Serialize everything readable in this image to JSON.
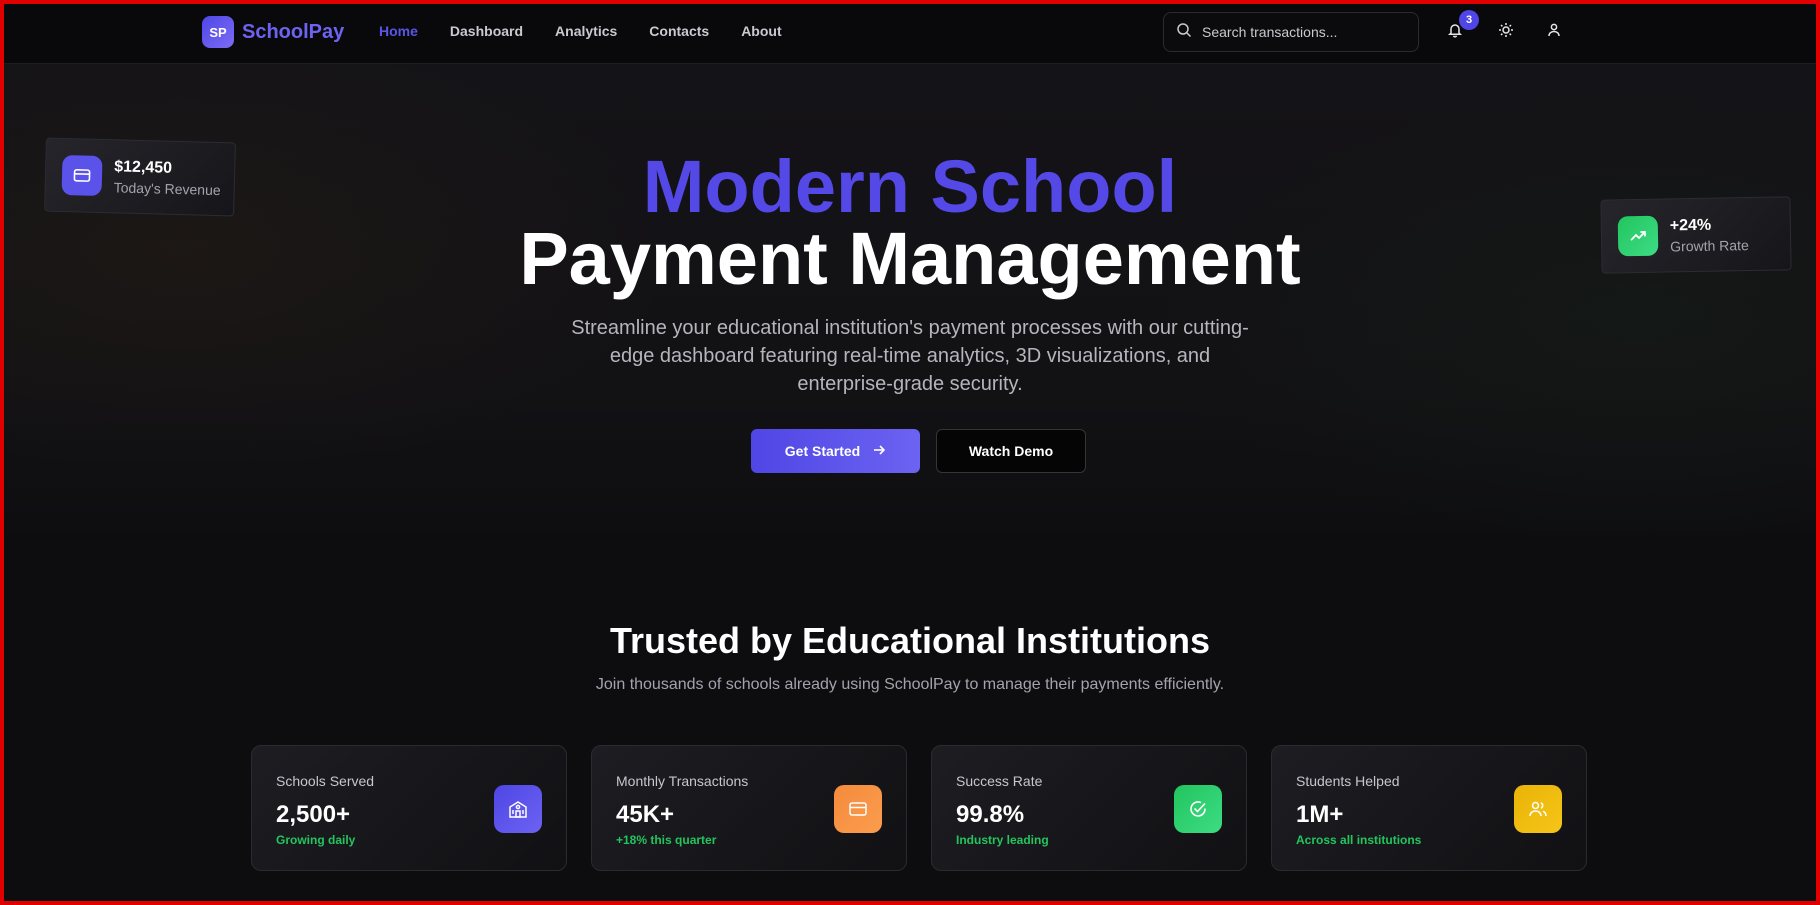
{
  "app": {
    "logo_badge": "SP",
    "name": "SchoolPay"
  },
  "nav": {
    "links": [
      "Home",
      "Dashboard",
      "Analytics",
      "Contacts",
      "About"
    ],
    "active": "Home"
  },
  "search": {
    "placeholder": "Search transactions...",
    "icon": "search-icon"
  },
  "notifications": {
    "count": "3",
    "icon": "bell-icon"
  },
  "theme_toggle": {
    "icon": "sun-icon"
  },
  "user_menu": {
    "icon": "user-icon"
  },
  "floating_cards": {
    "revenue": {
      "value": "$12,450",
      "label": "Today's Revenue",
      "icon": "credit-card-icon",
      "color": "#5b52ea"
    },
    "growth": {
      "value": "+24%",
      "label": "Growth Rate",
      "icon": "trending-up-icon",
      "color": "#22c55e"
    }
  },
  "hero": {
    "title_line1": "Modern School",
    "title_line2": "Payment Management",
    "subtitle": "Streamline your educational institution's payment processes with our cutting-edge dashboard featuring real-time analytics, 3D visualizations, and enterprise-grade security.",
    "primary_button": "Get Started",
    "secondary_button": "Watch Demo",
    "accent_color": "#5448e6"
  },
  "stats_section": {
    "title": "Trusted by Educational Institutions",
    "subtitle": "Join thousands of schools already using SchoolPay to manage their payments efficiently.",
    "cards": [
      {
        "label": "Schools Served",
        "value": "2,500+",
        "note": "Growing daily",
        "icon": "school-icon",
        "color": "#4f46e5"
      },
      {
        "label": "Monthly Transactions",
        "value": "45K+",
        "note": "+18% this quarter",
        "icon": "credit-card-icon",
        "color": "#f58a3c"
      },
      {
        "label": "Success Rate",
        "value": "99.8%",
        "note": "Industry leading",
        "icon": "check-circle-icon",
        "color": "#22c55e"
      },
      {
        "label": "Students Helped",
        "value": "1M+",
        "note": "Across all institutions",
        "icon": "users-icon",
        "color": "#eab308"
      }
    ]
  }
}
